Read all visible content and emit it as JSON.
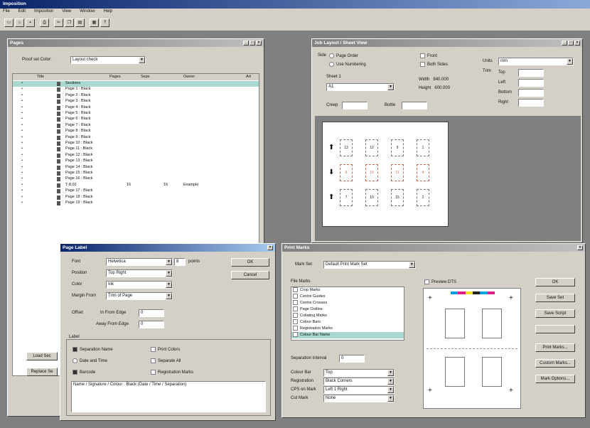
{
  "app": {
    "title": "Imposition",
    "menus": [
      "File",
      "Edit",
      "Imposition",
      "View",
      "Window",
      "Help"
    ]
  },
  "pages_window": {
    "title": "Pages",
    "proof_set_label": "Proof set Color:",
    "proof_set_value": "Layout check",
    "columns": [
      "Title",
      "Pages",
      "Seps",
      "Owner",
      "Art"
    ],
    "rows": [
      {
        "title": "Sections",
        "pages": "",
        "seps": "",
        "owner": "",
        "selected": true
      },
      {
        "title": "Page 1 : Black"
      },
      {
        "title": "Page 2 : Black"
      },
      {
        "title": "Page 3 : Black"
      },
      {
        "title": "Page 4 : Black"
      },
      {
        "title": "Page 5 : Black"
      },
      {
        "title": "Page 6 : Black"
      },
      {
        "title": "Page 7 : Black"
      },
      {
        "title": "Page 8 : Black"
      },
      {
        "title": "Page 9 : Black"
      },
      {
        "title": "Page 10 : Black"
      },
      {
        "title": "Page 11 : Black"
      },
      {
        "title": "Page 12 : Black"
      },
      {
        "title": "Page 13 : Black"
      },
      {
        "title": "Page 14 : Black"
      },
      {
        "title": "Page 15 : Black"
      },
      {
        "title": "Page 16 : Black"
      },
      {
        "title": "T-8.02",
        "pages": "16",
        "seps": "16",
        "owner": "Example"
      },
      {
        "title": "Page 17 : Black"
      },
      {
        "title": "Page 18 : Black"
      },
      {
        "title": "Page 19 : Black"
      }
    ],
    "load_button": "Load Sec",
    "replace_button": "Replace Se"
  },
  "layout_window": {
    "title": "Job Layout / Sheet View",
    "side_label": "Side",
    "side_opt1": "Page Order",
    "side_opt2": "Use Numbering",
    "view_label": "View",
    "view_opt1": "Front",
    "view_opt2": "Both Sides",
    "sheet_label": "Sheet",
    "sheet_value": "1",
    "sheet_combo": "A1",
    "width_label": "Width",
    "width_value": "840.000",
    "height_label": "Height",
    "height_value": "600.000",
    "creep_label": "Creep",
    "bottle_label": "Bottle",
    "units_label": "Units",
    "units_value": "mm",
    "trim_label": "Trim",
    "top_label": "Top",
    "left_label": "Left",
    "bottom_label": "Bottom",
    "right_label": "Right",
    "thumbs_row1": [
      "13",
      "12",
      "9",
      "1"
    ],
    "thumbs_row2": [
      "6",
      "10",
      "11",
      "4"
    ],
    "thumbs_row3": [
      "7",
      "10",
      "15",
      "2"
    ]
  },
  "label_dialog": {
    "title": "Page Label",
    "font_label": "Font",
    "font_value": "Helvetica",
    "size_value": "8",
    "size_unit": "points",
    "position_label": "Position",
    "position_value": "Top Right",
    "color_label": "Color",
    "color_value": "Ink",
    "margin_label": "Margin From",
    "margin_value": "Trim of Page",
    "offset_label": "Offset",
    "from_trim_label": "In From Edge",
    "from_trim_value": "0",
    "from_fold_label": "Away From Edge",
    "from_fold_value": "0",
    "label_section": "Label",
    "opt_sep_name": "Separation Name",
    "opt_date_time": "Date and Time",
    "opt_barcode": "Barcode",
    "opt_print_colors": "Print Colors",
    "opt_sep_all": "Separate All",
    "opt_reg_marks": "Registration Marks",
    "label_text": "Name / Signature / Colour : Black (Date / Time / Separation)",
    "ok": "OK",
    "cancel": "Cancel"
  },
  "marks_window": {
    "title": "Print Marks",
    "mark_set_label": "Mark Set",
    "mark_set_value": "Default Print Mark Set",
    "file_marks_label": "File Marks",
    "marks": [
      "Crop Marks",
      "Centre Guides",
      "Centre Crosses",
      "Page Outline",
      "Collating Marks",
      "Colour Bars",
      "Registration Marks",
      "Colour Bar Name"
    ],
    "preview_label": "Preview DTS",
    "sep_interval_label": "Separation Interval",
    "sep_interval_value": "0",
    "colour_bar_label": "Colour Bar",
    "colour_bar_value": "Top",
    "registration_label": "Registration",
    "registration_value": "Black Corners",
    "crop_marks_label": "CPS on Mark",
    "crop_marks_value": "Left 1 Right",
    "cut_mark_label": "Cut Mark",
    "cut_mark_value": "None",
    "btn_ok": "OK",
    "btn_save_set": "Save Set",
    "btn_save_script": "Save Script",
    "btn_blank": "",
    "btn_print_marks": "Print Marks...",
    "btn_custom": "Custom Marks...",
    "btn_mark_options": "Mark Options...",
    "colors": {
      "cyan": "#00a0e0",
      "magenta": "#e0208a",
      "yellow": "#f0e020",
      "black": "#222222"
    }
  }
}
